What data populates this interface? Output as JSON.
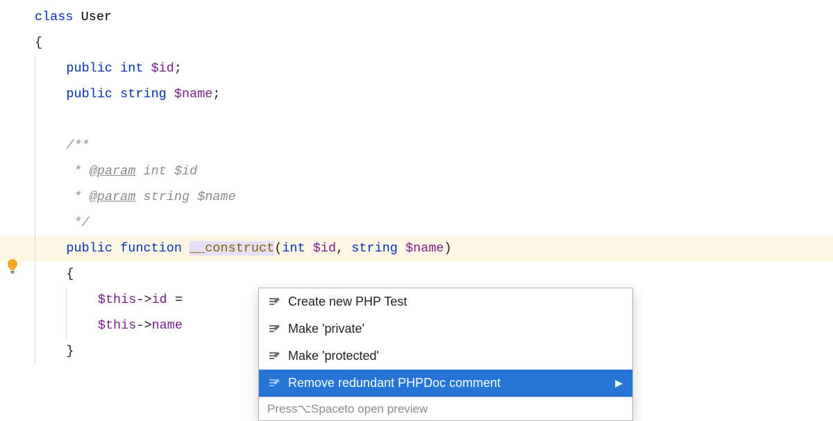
{
  "code": {
    "class_kw": "class",
    "class_name": "User",
    "brace_open": "{",
    "brace_close": "}",
    "public_kw": "public",
    "int_type": "int",
    "string_type": "string",
    "var_id": "$id",
    "var_name": "$name",
    "semicolon": ";",
    "doc_open": "/**",
    "doc_star": " *",
    "doc_tag": "@param",
    "doc_int": "int",
    "doc_string": "string",
    "doc_var_id": "$id",
    "doc_var_name": "$name",
    "doc_close": " */",
    "function_kw": "function",
    "construct": "__construct",
    "paren_open": "(",
    "paren_close": ")",
    "comma": ",",
    "this": "$this",
    "arrow": "->",
    "prop_id": "id",
    "prop_name": "name",
    "equals": "=",
    "space": " "
  },
  "popup": {
    "items": [
      {
        "label": "Create new PHP Test"
      },
      {
        "label": "Make 'private'"
      },
      {
        "label": "Make 'protected'"
      },
      {
        "label": "Remove redundant PHPDoc comment"
      }
    ],
    "footer_prefix": "Press ",
    "footer_key": "⌥Space",
    "footer_suffix": " to open preview"
  }
}
